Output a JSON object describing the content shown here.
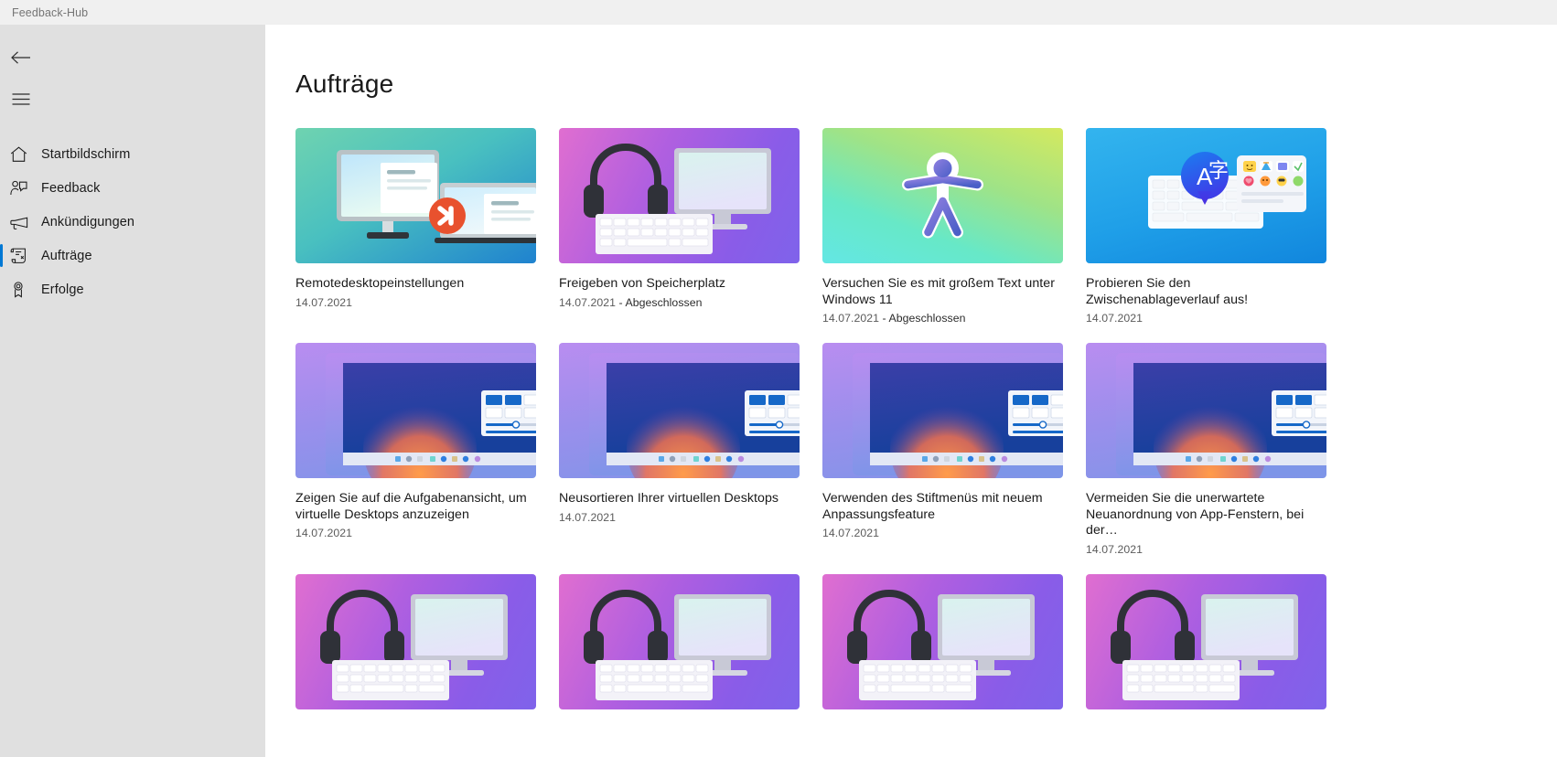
{
  "window": {
    "title": "Feedback-Hub"
  },
  "sidebar": {
    "back_icon": "back-arrow-icon",
    "menu_icon": "hamburger-menu-icon",
    "items": [
      {
        "label": "Startbildschirm",
        "icon": "home-icon",
        "selected": false
      },
      {
        "label": "Feedback",
        "icon": "feedback-person-icon",
        "selected": false
      },
      {
        "label": "Ankündigungen",
        "icon": "megaphone-icon",
        "selected": false
      },
      {
        "label": "Aufträge",
        "icon": "scroll-quest-icon",
        "selected": true
      },
      {
        "label": "Erfolge",
        "icon": "award-medal-icon",
        "selected": false
      }
    ]
  },
  "main": {
    "page_title": "Aufträge",
    "cards": [
      {
        "title": "Remotedesktopeinstellungen",
        "date": "14.07.2021",
        "status": "",
        "art": "rdp"
      },
      {
        "title": "Freigeben von Speicherplatz",
        "date": "14.07.2021",
        "status": " - Abgeschlossen",
        "art": "headset"
      },
      {
        "title": "Versuchen Sie es mit großem Text unter Windows 11",
        "date": "14.07.2021",
        "status": " - Abgeschlossen",
        "art": "accessibility"
      },
      {
        "title": "Probieren Sie den Zwischenablageverlauf aus!",
        "date": "14.07.2021",
        "status": "",
        "art": "clipboard"
      },
      {
        "title": "Zeigen Sie auf die Aufgabenansicht, um virtuelle Desktops anzuzeigen",
        "date": "14.07.2021",
        "status": "",
        "art": "virtualdesktop"
      },
      {
        "title": "Neusortieren Ihrer virtuellen Desktops",
        "date": "14.07.2021",
        "status": "",
        "art": "virtualdesktop"
      },
      {
        "title": "Verwenden des Stiftmenüs mit neuem Anpassungsfeature",
        "date": "14.07.2021",
        "status": "",
        "art": "virtualdesktop"
      },
      {
        "title": "Vermeiden Sie die unerwartete Neuanordnung von App-Fenstern, bei der…",
        "date": "14.07.2021",
        "status": "",
        "art": "virtualdesktop"
      },
      {
        "title": "",
        "date": "",
        "status": "",
        "art": "headset"
      },
      {
        "title": "",
        "date": "",
        "status": "",
        "art": "headset"
      },
      {
        "title": "",
        "date": "",
        "status": "",
        "art": "headset"
      },
      {
        "title": "",
        "date": "",
        "status": "",
        "art": "headset"
      }
    ]
  },
  "colors": {
    "accent": "#0078d4",
    "titlebar_bg": "#f0f0f0",
    "sidebar_bg": "#e0e0e0",
    "content_bg": "#ffffff",
    "text_primary": "#1a1a1a",
    "text_secondary": "#5a5a5a"
  }
}
